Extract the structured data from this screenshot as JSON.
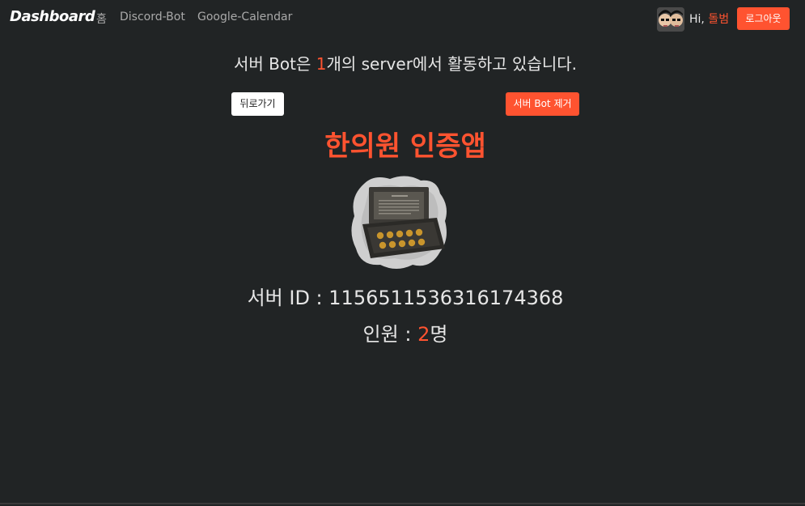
{
  "nav": {
    "brand": "Dashboard",
    "links": [
      "홈",
      "Discord-Bot",
      "Google-Calendar"
    ],
    "greeting_prefix": "Hi,",
    "username": "돌범",
    "logout_label": "로그아웃",
    "avatar_icon": "user-avatar-icon"
  },
  "headline": {
    "before_bot": "서버 Bot은 ",
    "count": "1",
    "after_count": "개의 server에서 활동하고 있습니다."
  },
  "actions": {
    "back_label": "뒤로가기",
    "remove_label": "서버 Bot 제거"
  },
  "server": {
    "name": "한의원 인증앱",
    "icon": "server-icon-coin-box",
    "id_label": "서버 ID : ",
    "id_value": "1156511536316174368",
    "members_label": "인원 : ",
    "members_count": "2",
    "members_unit": "명"
  },
  "colors": {
    "accent": "#ff5330",
    "background": "#212425",
    "text": "#e6e6e6"
  }
}
